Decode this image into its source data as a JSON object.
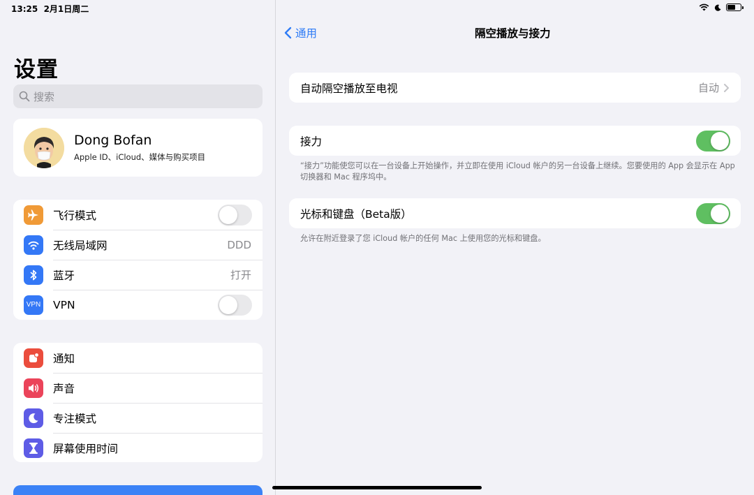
{
  "status": {
    "time": "13:25",
    "date": "2月1日周二"
  },
  "sidebar": {
    "title": "设置",
    "search_placeholder": "搜索",
    "profile": {
      "name": "Dong Bofan",
      "subtitle": "Apple ID、iCloud、媒体与购买项目"
    },
    "group1": [
      {
        "label": "飞行模式",
        "icon": "airplane-icon",
        "color": "#f09a37",
        "toggle": false
      },
      {
        "label": "无线局域网",
        "icon": "wifi-icon",
        "color": "#3478f6",
        "value": "DDD"
      },
      {
        "label": "蓝牙",
        "icon": "bluetooth-icon",
        "color": "#3478f6",
        "value": "打开"
      },
      {
        "label": "VPN",
        "icon": "vpn-icon",
        "color": "#3478f6",
        "toggle": false,
        "badge": "VPN"
      }
    ],
    "group2": [
      {
        "label": "通知",
        "icon": "notification-icon",
        "color": "#eb4d3d"
      },
      {
        "label": "声音",
        "icon": "sound-icon",
        "color": "#eb445a"
      },
      {
        "label": "专注模式",
        "icon": "moon-icon",
        "color": "#5e5ce6"
      },
      {
        "label": "屏幕使用时间",
        "icon": "hourglass-icon",
        "color": "#5e5ce6"
      }
    ]
  },
  "detail": {
    "back_label": "通用",
    "title": "隔空播放与接力",
    "airplay": {
      "label": "自动隔空播放至电视",
      "value": "自动"
    },
    "handoff": {
      "label": "接力",
      "on": true,
      "footnote": "“接力”功能使您可以在一台设备上开始操作，并立即在使用 iCloud 帐户的另一台设备上继续。您要使用的 App 会显示在 App 切换器和 Mac 程序坞中。"
    },
    "cursor": {
      "label": "光标和键盘（Beta版）",
      "on": true,
      "footnote": "允许在附近登录了您 iCloud 帐户的任何 Mac 上使用您的光标和键盘。"
    }
  }
}
